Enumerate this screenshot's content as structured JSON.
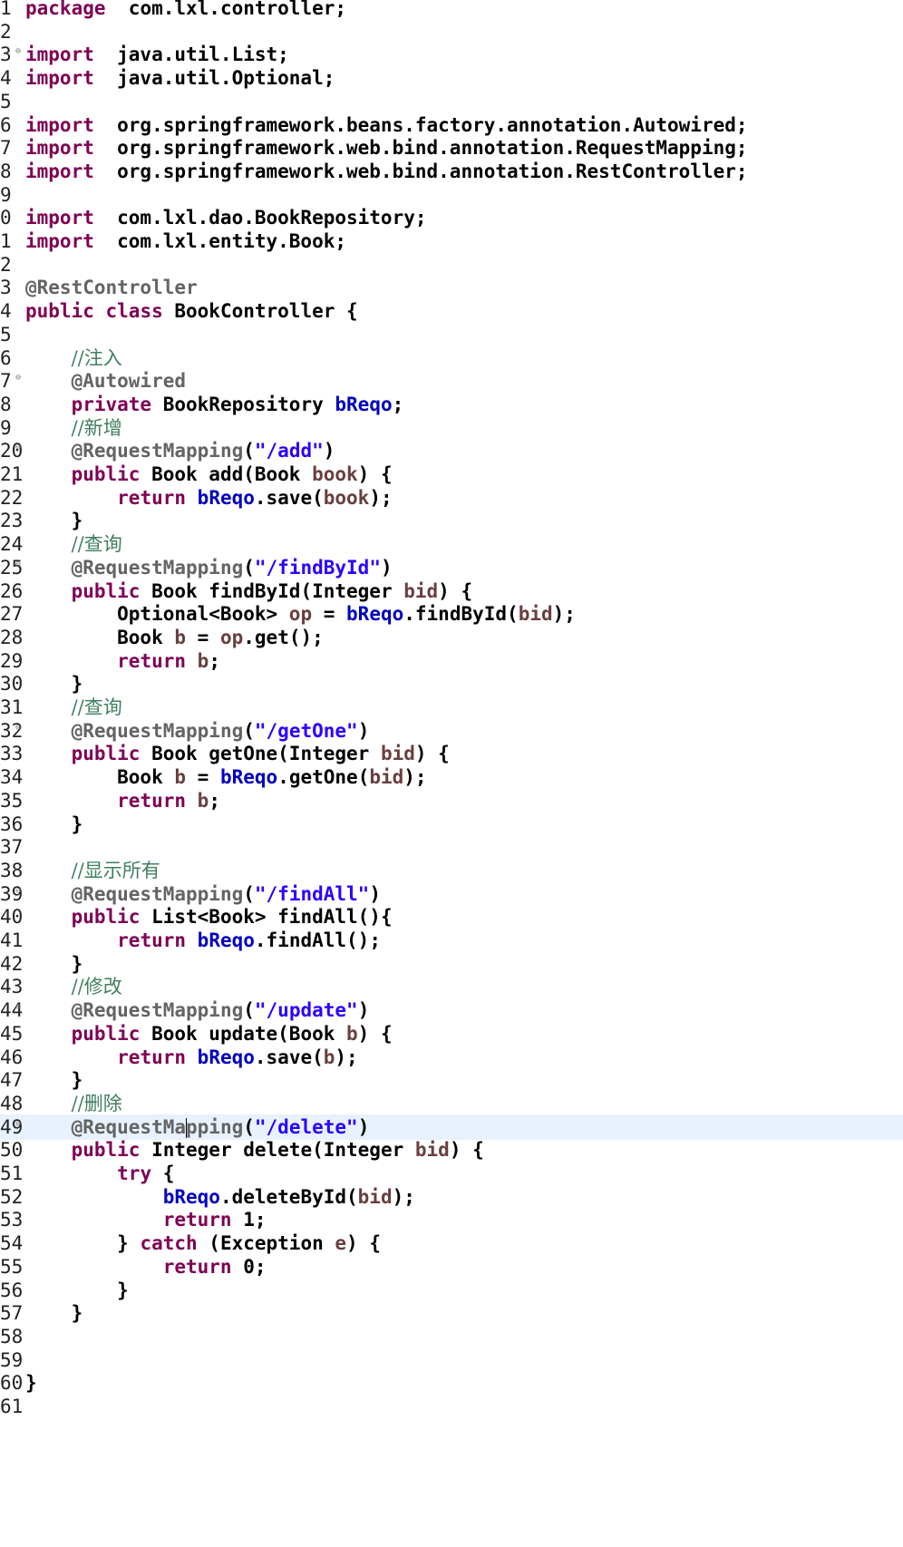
{
  "editor": {
    "current_line": 49,
    "lines": [
      {
        "n": "1",
        "fold": false,
        "tokens": [
          [
            "kw",
            "package"
          ],
          [
            "",
            "  com.lxl.controller;"
          ]
        ]
      },
      {
        "n": "2",
        "fold": false,
        "tokens": []
      },
      {
        "n": "3",
        "fold": true,
        "tokens": [
          [
            "kw",
            "import"
          ],
          [
            "",
            "  java.util.List;"
          ]
        ]
      },
      {
        "n": "4",
        "fold": false,
        "tokens": [
          [
            "kw",
            "import"
          ],
          [
            "",
            "  java.util.Optional;"
          ]
        ]
      },
      {
        "n": "5",
        "fold": false,
        "tokens": []
      },
      {
        "n": "6",
        "fold": false,
        "tokens": [
          [
            "kw",
            "import"
          ],
          [
            "",
            "  org.springframework.beans.factory.annotation.Autowired;"
          ]
        ]
      },
      {
        "n": "7",
        "fold": false,
        "tokens": [
          [
            "kw",
            "import"
          ],
          [
            "",
            "  org.springframework.web.bind.annotation.RequestMapping;"
          ]
        ]
      },
      {
        "n": "8",
        "fold": false,
        "tokens": [
          [
            "kw",
            "import"
          ],
          [
            "",
            "  org.springframework.web.bind.annotation.RestController;"
          ]
        ]
      },
      {
        "n": "9",
        "fold": false,
        "tokens": []
      },
      {
        "n": "0",
        "fold": false,
        "tokens": [
          [
            "kw",
            "import"
          ],
          [
            "",
            "  com.lxl.dao.BookRepository;"
          ]
        ]
      },
      {
        "n": "1",
        "fold": false,
        "tokens": [
          [
            "kw",
            "import"
          ],
          [
            "",
            "  com.lxl.entity.Book;"
          ]
        ]
      },
      {
        "n": "2",
        "fold": false,
        "tokens": []
      },
      {
        "n": "3",
        "fold": false,
        "tokens": [
          [
            "ann",
            "@RestController"
          ]
        ]
      },
      {
        "n": "4",
        "fold": false,
        "tokens": [
          [
            "kw",
            "public"
          ],
          [
            "",
            " "
          ],
          [
            "kw",
            "class"
          ],
          [
            "",
            " BookController {"
          ]
        ]
      },
      {
        "n": "5",
        "fold": false,
        "tokens": []
      },
      {
        "n": "6",
        "fold": false,
        "tokens": [
          [
            "",
            "    "
          ],
          [
            "cmt",
            "//注入"
          ]
        ]
      },
      {
        "n": "7",
        "fold": true,
        "tokens": [
          [
            "",
            "    "
          ],
          [
            "ann",
            "@Autowired"
          ]
        ]
      },
      {
        "n": "8",
        "fold": false,
        "tokens": [
          [
            "",
            "    "
          ],
          [
            "kw",
            "private"
          ],
          [
            "",
            " BookRepository "
          ],
          [
            "fld",
            "bReqo"
          ],
          [
            "",
            ";"
          ]
        ]
      },
      {
        "n": "9",
        "fold": false,
        "tokens": [
          [
            "",
            "    "
          ],
          [
            "cmt",
            "//新增"
          ]
        ]
      },
      {
        "n": "20",
        "fold": true,
        "tokens": [
          [
            "",
            "    "
          ],
          [
            "ann",
            "@RequestMapping"
          ],
          [
            "",
            "("
          ],
          [
            "str",
            "\"/add\""
          ],
          [
            "",
            ")"
          ]
        ]
      },
      {
        "n": "21",
        "fold": false,
        "tokens": [
          [
            "",
            "    "
          ],
          [
            "kw",
            "public"
          ],
          [
            "",
            " Book add(Book "
          ],
          [
            "var",
            "book"
          ],
          [
            "",
            ") {"
          ]
        ]
      },
      {
        "n": "22",
        "fold": false,
        "tokens": [
          [
            "",
            "        "
          ],
          [
            "kw",
            "return"
          ],
          [
            "",
            " "
          ],
          [
            "fld",
            "bReqo"
          ],
          [
            "",
            ".save("
          ],
          [
            "var",
            "book"
          ],
          [
            "",
            ");"
          ]
        ]
      },
      {
        "n": "23",
        "fold": false,
        "tokens": [
          [
            "",
            "    }"
          ]
        ]
      },
      {
        "n": "24",
        "fold": false,
        "tokens": [
          [
            "",
            "    "
          ],
          [
            "cmt",
            "//查询"
          ]
        ]
      },
      {
        "n": "25",
        "fold": true,
        "tokens": [
          [
            "",
            "    "
          ],
          [
            "ann",
            "@RequestMapping"
          ],
          [
            "",
            "("
          ],
          [
            "str",
            "\"/findById\""
          ],
          [
            "",
            ")"
          ]
        ]
      },
      {
        "n": "26",
        "fold": false,
        "tokens": [
          [
            "",
            "    "
          ],
          [
            "kw",
            "public"
          ],
          [
            "",
            " Book findById(Integer "
          ],
          [
            "var",
            "bid"
          ],
          [
            "",
            ") {"
          ]
        ]
      },
      {
        "n": "27",
        "fold": false,
        "tokens": [
          [
            "",
            "        Optional<Book> "
          ],
          [
            "var",
            "op"
          ],
          [
            "",
            " = "
          ],
          [
            "fld",
            "bReqo"
          ],
          [
            "",
            ".findById("
          ],
          [
            "var",
            "bid"
          ],
          [
            "",
            ");"
          ]
        ]
      },
      {
        "n": "28",
        "fold": false,
        "tokens": [
          [
            "",
            "        Book "
          ],
          [
            "var",
            "b"
          ],
          [
            "",
            " = "
          ],
          [
            "var",
            "op"
          ],
          [
            "",
            ".get();"
          ]
        ]
      },
      {
        "n": "29",
        "fold": false,
        "tokens": [
          [
            "",
            "        "
          ],
          [
            "kw",
            "return"
          ],
          [
            "",
            " "
          ],
          [
            "var",
            "b"
          ],
          [
            "",
            ";"
          ]
        ]
      },
      {
        "n": "30",
        "fold": false,
        "tokens": [
          [
            "",
            "    }"
          ]
        ]
      },
      {
        "n": "31",
        "fold": false,
        "tokens": [
          [
            "",
            "    "
          ],
          [
            "cmt",
            "//查询"
          ]
        ]
      },
      {
        "n": "32",
        "fold": true,
        "tokens": [
          [
            "",
            "    "
          ],
          [
            "ann",
            "@RequestMapping"
          ],
          [
            "",
            "("
          ],
          [
            "str",
            "\"/getOne\""
          ],
          [
            "",
            ")"
          ]
        ]
      },
      {
        "n": "33",
        "fold": false,
        "tokens": [
          [
            "",
            "    "
          ],
          [
            "kw",
            "public"
          ],
          [
            "",
            " Book getOne(Integer "
          ],
          [
            "var",
            "bid"
          ],
          [
            "",
            ") {"
          ]
        ]
      },
      {
        "n": "34",
        "fold": false,
        "tokens": [
          [
            "",
            "        Book "
          ],
          [
            "var",
            "b"
          ],
          [
            "",
            " = "
          ],
          [
            "fld",
            "bReqo"
          ],
          [
            "",
            ".getOne("
          ],
          [
            "var",
            "bid"
          ],
          [
            "",
            ");"
          ]
        ]
      },
      {
        "n": "35",
        "fold": false,
        "tokens": [
          [
            "",
            "        "
          ],
          [
            "kw",
            "return"
          ],
          [
            "",
            " "
          ],
          [
            "var",
            "b"
          ],
          [
            "",
            ";"
          ]
        ]
      },
      {
        "n": "36",
        "fold": false,
        "tokens": [
          [
            "",
            "    }"
          ]
        ]
      },
      {
        "n": "37",
        "fold": false,
        "tokens": []
      },
      {
        "n": "38",
        "fold": false,
        "tokens": [
          [
            "",
            "    "
          ],
          [
            "cmt",
            "//显示所有"
          ]
        ]
      },
      {
        "n": "39",
        "fold": true,
        "tokens": [
          [
            "",
            "    "
          ],
          [
            "ann",
            "@RequestMapping"
          ],
          [
            "",
            "("
          ],
          [
            "str",
            "\"/findAll\""
          ],
          [
            "",
            ")"
          ]
        ]
      },
      {
        "n": "40",
        "fold": false,
        "tokens": [
          [
            "",
            "    "
          ],
          [
            "kw",
            "public"
          ],
          [
            "",
            " List<Book> findAll(){"
          ]
        ]
      },
      {
        "n": "41",
        "fold": false,
        "tokens": [
          [
            "",
            "        "
          ],
          [
            "kw",
            "return"
          ],
          [
            "",
            " "
          ],
          [
            "fld",
            "bReqo"
          ],
          [
            "",
            ".findAll();"
          ]
        ]
      },
      {
        "n": "42",
        "fold": false,
        "tokens": [
          [
            "",
            "    }"
          ]
        ]
      },
      {
        "n": "43",
        "fold": false,
        "tokens": [
          [
            "",
            "    "
          ],
          [
            "cmt",
            "//修改"
          ]
        ]
      },
      {
        "n": "44",
        "fold": true,
        "tokens": [
          [
            "",
            "    "
          ],
          [
            "ann",
            "@RequestMapping"
          ],
          [
            "",
            "("
          ],
          [
            "str",
            "\"/update\""
          ],
          [
            "",
            ")"
          ]
        ]
      },
      {
        "n": "45",
        "fold": false,
        "tokens": [
          [
            "",
            "    "
          ],
          [
            "kw",
            "public"
          ],
          [
            "",
            " Book update(Book "
          ],
          [
            "var",
            "b"
          ],
          [
            "",
            ") {"
          ]
        ]
      },
      {
        "n": "46",
        "fold": false,
        "tokens": [
          [
            "",
            "        "
          ],
          [
            "kw",
            "return"
          ],
          [
            "",
            " "
          ],
          [
            "fld",
            "bReqo"
          ],
          [
            "",
            ".save("
          ],
          [
            "var",
            "b"
          ],
          [
            "",
            ");"
          ]
        ]
      },
      {
        "n": "47",
        "fold": false,
        "tokens": [
          [
            "",
            "    }"
          ]
        ]
      },
      {
        "n": "48",
        "fold": false,
        "tokens": [
          [
            "",
            "    "
          ],
          [
            "cmt",
            "//删除"
          ]
        ]
      },
      {
        "n": "49",
        "fold": true,
        "tokens": [
          [
            "",
            "    "
          ],
          [
            "ann",
            "@RequestMa"
          ],
          [
            "caret",
            ""
          ],
          [
            "ann",
            "pping"
          ],
          [
            "",
            "("
          ],
          [
            "str",
            "\"/delete\""
          ],
          [
            "",
            ")"
          ]
        ]
      },
      {
        "n": "50",
        "fold": false,
        "tokens": [
          [
            "",
            "    "
          ],
          [
            "kw",
            "public"
          ],
          [
            "",
            " Integer delete(Integer "
          ],
          [
            "var",
            "bid"
          ],
          [
            "",
            ") {"
          ]
        ]
      },
      {
        "n": "51",
        "fold": false,
        "tokens": [
          [
            "",
            "        "
          ],
          [
            "kw",
            "try"
          ],
          [
            "",
            " {"
          ]
        ]
      },
      {
        "n": "52",
        "fold": false,
        "tokens": [
          [
            "",
            "            "
          ],
          [
            "fld",
            "bReqo"
          ],
          [
            "",
            ".deleteById("
          ],
          [
            "var",
            "bid"
          ],
          [
            "",
            ");"
          ]
        ]
      },
      {
        "n": "53",
        "fold": false,
        "tokens": [
          [
            "",
            "            "
          ],
          [
            "kw",
            "return"
          ],
          [
            "",
            " 1;"
          ]
        ]
      },
      {
        "n": "54",
        "fold": false,
        "tokens": [
          [
            "",
            "        } "
          ],
          [
            "kw",
            "catch"
          ],
          [
            "",
            " (Exception "
          ],
          [
            "var",
            "e"
          ],
          [
            "",
            ") {"
          ]
        ]
      },
      {
        "n": "55",
        "fold": false,
        "tokens": [
          [
            "",
            "            "
          ],
          [
            "kw",
            "return"
          ],
          [
            "",
            " 0;"
          ]
        ]
      },
      {
        "n": "56",
        "fold": false,
        "tokens": [
          [
            "",
            "        }"
          ]
        ]
      },
      {
        "n": "57",
        "fold": false,
        "tokens": [
          [
            "",
            "    }"
          ]
        ]
      },
      {
        "n": "58",
        "fold": false,
        "tokens": []
      },
      {
        "n": "59",
        "fold": false,
        "tokens": []
      },
      {
        "n": "60",
        "fold": false,
        "tokens": [
          [
            "",
            "}"
          ]
        ]
      },
      {
        "n": "61",
        "fold": false,
        "tokens": []
      }
    ]
  }
}
